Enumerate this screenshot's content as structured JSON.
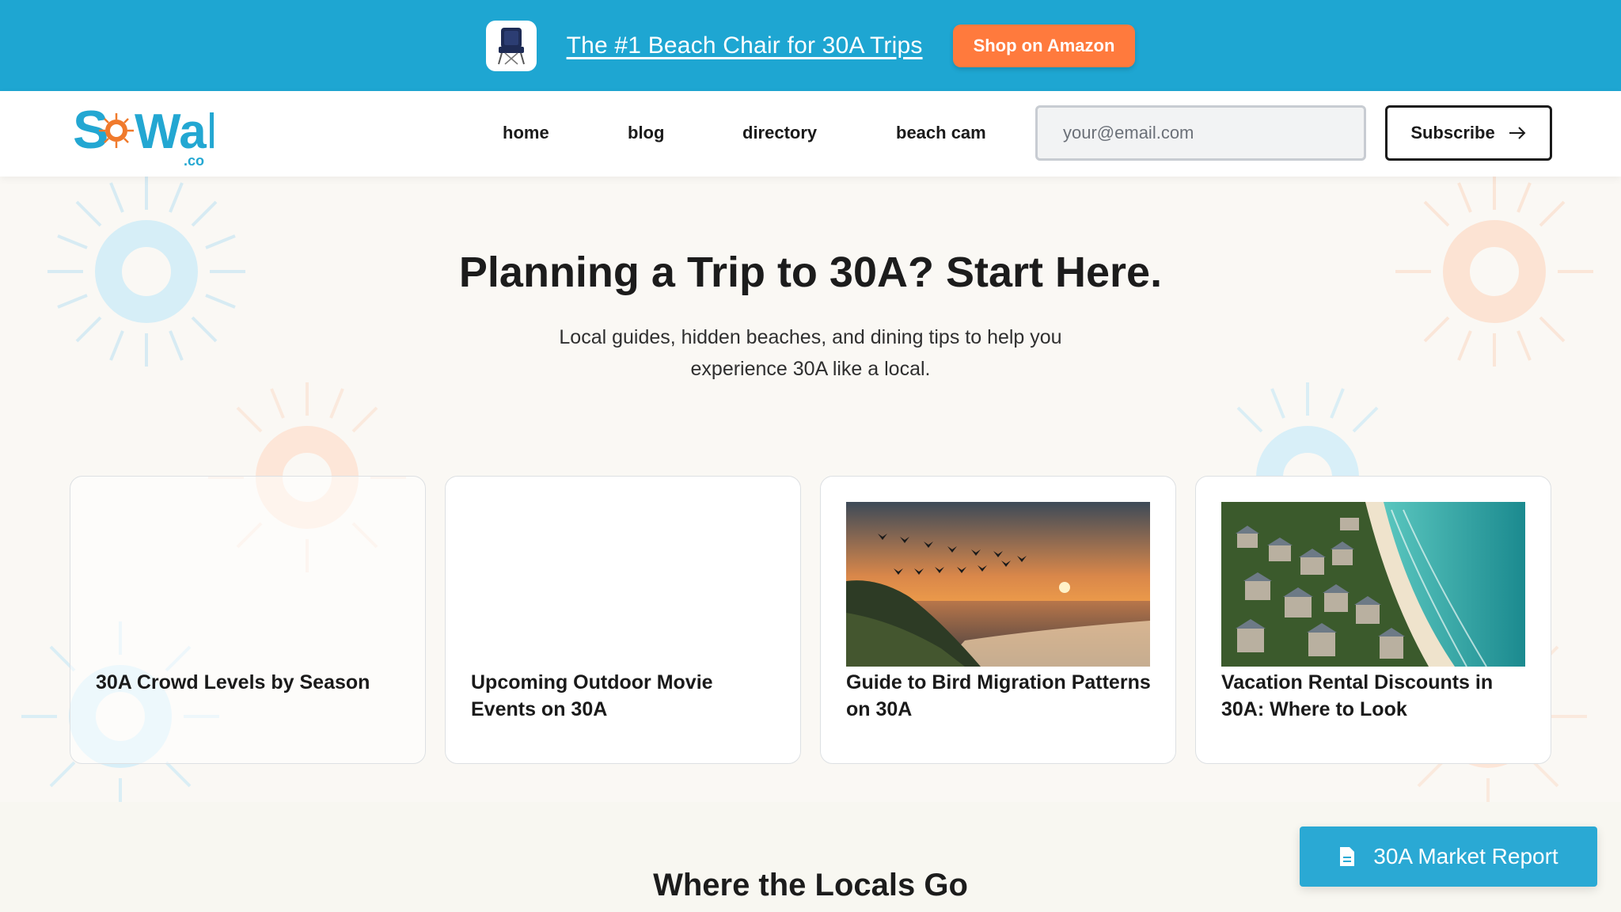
{
  "promo": {
    "link_text": "The #1 Beach Chair for 30A Trips",
    "button_label": "Shop on Amazon",
    "thumb_icon": "beach-chair-icon"
  },
  "header": {
    "logo_text": "SoWal",
    "logo_suffix": ".co",
    "nav": [
      "home",
      "blog",
      "directory",
      "beach cam"
    ],
    "email_placeholder": "your@email.com",
    "subscribe_label": "Subscribe",
    "subscribe_icon": "arrow-right-icon"
  },
  "hero": {
    "title": "Planning a Trip to 30A? Start Here.",
    "subtitle_line1": "Local guides, hidden beaches, and dining tips to help you",
    "subtitle_line2": "experience 30A like a local."
  },
  "cards": [
    {
      "title": "30A Crowd Levels by Season",
      "image": "none"
    },
    {
      "title": "Upcoming Outdoor Movie Events on 30A",
      "image": "none"
    },
    {
      "title": "Guide to Bird Migration Patterns on 30A",
      "image": "sunset-birds-photo"
    },
    {
      "title": "Vacation Rental Discounts in 30A: Where to Look",
      "image": "aerial-beach-homes-photo"
    }
  ],
  "locals": {
    "title": "Where the Locals Go"
  },
  "floating_button": {
    "label": "30A Market Report",
    "icon": "document-icon"
  },
  "colors": {
    "banner": "#1ea6d2",
    "accent_orange": "#ff7a3d",
    "logo_blue": "#23a7d2",
    "market_button": "#2aa9d4"
  }
}
